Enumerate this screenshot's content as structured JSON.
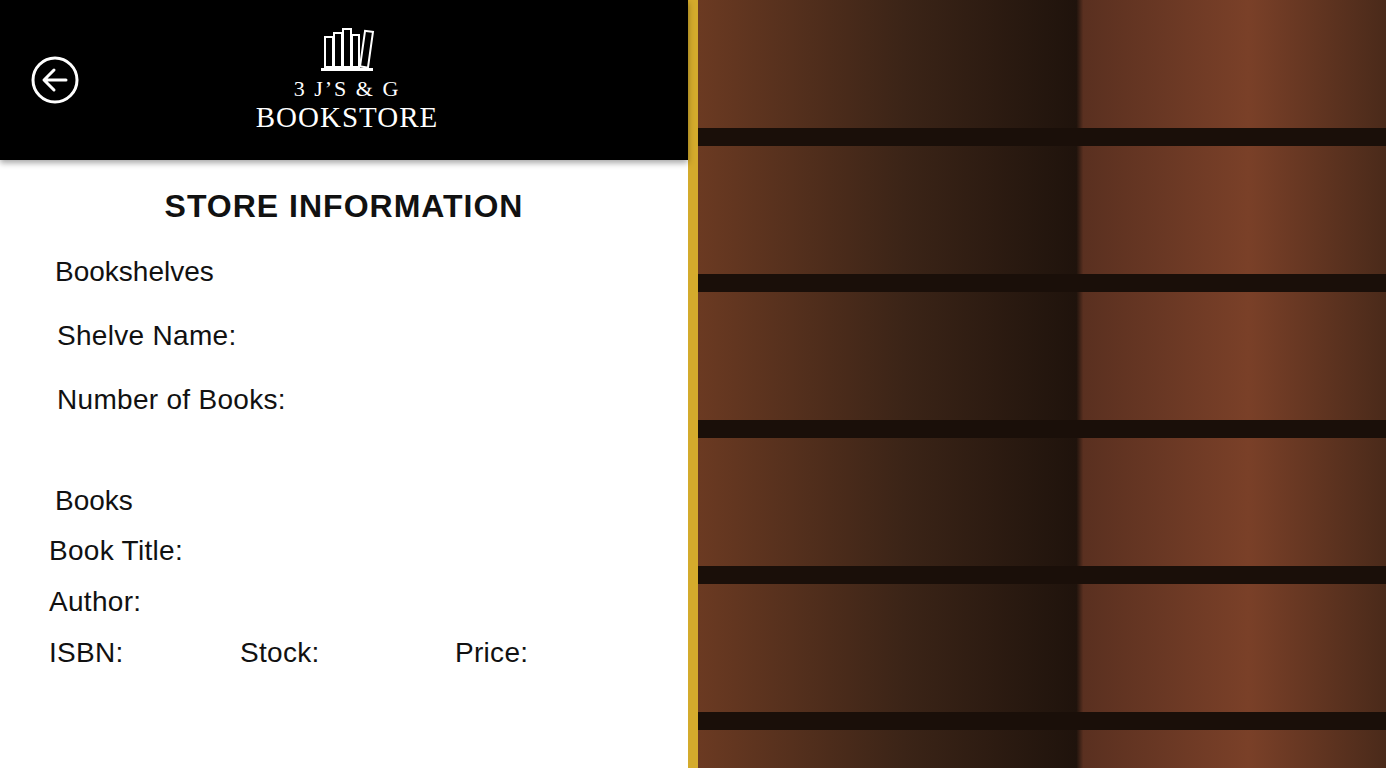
{
  "header": {
    "logo": {
      "line1": "3 J’S & G",
      "line2": "BOOKSTORE"
    }
  },
  "page": {
    "title": "STORE INFORMATION"
  },
  "bookshelves": {
    "heading": "Bookshelves",
    "fields": [
      "Shelve Name:",
      "Number of Books:"
    ]
  },
  "books": {
    "heading": "Books",
    "fields": [
      "Book Title:",
      "Author:"
    ],
    "row": [
      "ISBN:",
      "Stock:",
      "Price:"
    ]
  }
}
